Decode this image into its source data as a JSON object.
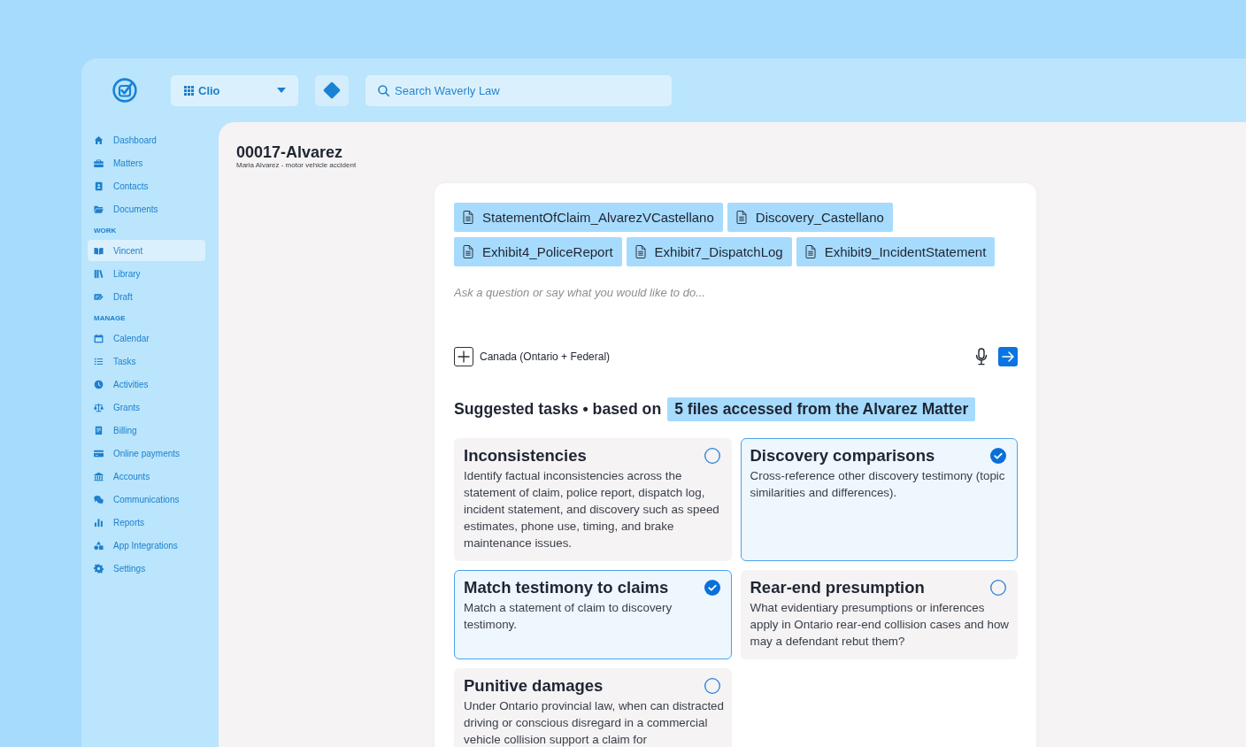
{
  "topbar": {
    "app_switcher": {
      "label": "Clio"
    },
    "search": {
      "placeholder": "Search Waverly Law"
    }
  },
  "sidebar": {
    "items": [
      {
        "label": "Dashboard",
        "selected": false
      },
      {
        "label": "Matters",
        "selected": false
      },
      {
        "label": "Contacts",
        "selected": false
      },
      {
        "label": "Documents",
        "selected": false
      }
    ],
    "sections": [
      {
        "heading": "WORK",
        "items": [
          {
            "label": "Vincent",
            "selected": true
          },
          {
            "label": "Library",
            "selected": false
          },
          {
            "label": "Draft",
            "selected": false
          }
        ]
      },
      {
        "heading": "MANAGE",
        "items": [
          {
            "label": "Calendar",
            "selected": false
          },
          {
            "label": "Tasks",
            "selected": false
          },
          {
            "label": "Activities",
            "selected": false
          },
          {
            "label": "Grants",
            "selected": false
          },
          {
            "label": "Billing",
            "selected": false
          },
          {
            "label": "Online payments",
            "selected": false
          },
          {
            "label": "Accounts",
            "selected": false
          },
          {
            "label": "Communications",
            "selected": false
          },
          {
            "label": "Reports",
            "selected": false
          },
          {
            "label": "App Integrations",
            "selected": false
          },
          {
            "label": "Settings",
            "selected": false
          }
        ]
      }
    ]
  },
  "matter": {
    "title": "00017-Alvarez",
    "subtitle": "Maria Alvarez - motor vehicle accident"
  },
  "assistant": {
    "attachments": [
      "StatementOfClaim_AlvarezVCastellano",
      "Discovery_Castellano",
      "Exhibit4_PoliceReport",
      "Exhibit7_DispatchLog",
      "Exhibit9_IncidentStatement"
    ],
    "prompt": {
      "placeholder": "Ask a question or say what you would like to do..."
    },
    "jurisdiction": "Canada (Ontario + Federal)",
    "suggestions": {
      "heading": "Suggested tasks • based on",
      "source": "5 files accessed from the Alvarez Matter",
      "tasks": [
        {
          "title": "Inconsistencies",
          "description": "Identify factual inconsistencies across the statement of claim, police report, dispatch log, incident statement, and discovery such as speed estimates, phone use, timing, and brake maintenance issues.",
          "selected": false
        },
        {
          "title": "Discovery comparisons",
          "description": "Cross-reference other discovery testimony (topic similarities and differences).",
          "selected": true
        },
        {
          "title": "Match testimony to claims",
          "description": "Match a statement of claim to discovery testimony.",
          "selected": true
        },
        {
          "title": "Rear-end presumption",
          "description": "What evidentiary presumptions or inferences apply in Ontario rear-end collision cases and how may a defendant rebut them?",
          "selected": false
        },
        {
          "title": "Punitive damages",
          "description": "Under Ontario provincial law, when can distracted driving or conscious disregard in a commercial vehicle collision support a claim for",
          "selected": false
        }
      ]
    }
  }
}
